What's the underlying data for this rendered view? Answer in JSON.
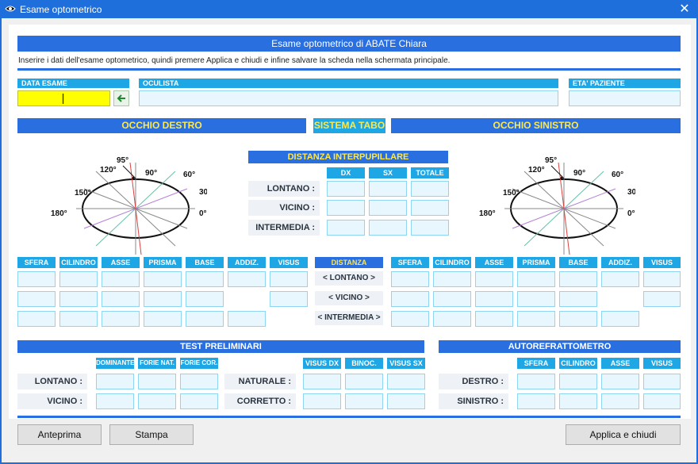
{
  "window": {
    "title": "Esame optometrico",
    "close_glyph": "✕"
  },
  "header": {
    "title": "Esame optometrico di ABATE Chiara",
    "instructions": "Inserire i dati dell'esame optometrico, quindi premere Applica e chiudi e infine salvare la scheda nella schermata principale."
  },
  "top_fields": {
    "date_label": "DATA ESAME",
    "date_value": "",
    "oculist_label": "OCULISTA",
    "oculist_value": "",
    "age_label": "ETA' PAZIENTE",
    "age_value": "",
    "arrow_icon": "arrow-left-icon"
  },
  "eyes": {
    "right_title": "OCCHIO DESTRO",
    "tabo_title": "SISTEMA TABO",
    "left_title": "OCCHIO SINISTRO",
    "angle_labels": [
      "95°",
      "120°",
      "90°",
      "60°",
      "150°",
      "30°",
      "180°",
      "0°"
    ]
  },
  "interpupillary": {
    "title": "DISTANZA INTERPUPILLARE",
    "columns": [
      "DX",
      "SX",
      "TOTALE"
    ],
    "rows": [
      "LONTANO :",
      "VICINO :",
      "INTERMEDIA :"
    ]
  },
  "prescription": {
    "columns": [
      "SFERA",
      "CILINDRO",
      "ASSE",
      "PRISMA",
      "BASE",
      "ADDIZ.",
      "VISUS"
    ],
    "distance_header": "DISTANZA",
    "distance_buttons": [
      "< LONTANO >",
      "< VICINO >",
      "< INTERMEDIA >"
    ]
  },
  "preliminary": {
    "title": "TEST PRELIMINARI",
    "columns_left": [
      "DOMINANTE",
      "FORIE NAT.",
      "FORIE COR."
    ],
    "rows_left": [
      "LONTANO :",
      "VICINO :"
    ],
    "columns_right": [
      "VISUS DX",
      "BINOC.",
      "VISUS SX"
    ],
    "rows_right": [
      "NATURALE :",
      "CORRETTO :"
    ]
  },
  "autorefract": {
    "title": "AUTOREFRATTOMETRO",
    "columns": [
      "SFERA",
      "CILINDRO",
      "ASSE",
      "VISUS"
    ],
    "rows": [
      "DESTRO :",
      "SINISTRO :"
    ]
  },
  "buttons": {
    "preview": "Anteprima",
    "print": "Stampa",
    "apply": "Applica e chiudi"
  },
  "colors": {
    "titlebar": "#1e6fdc",
    "header_bar": "#2a6fe0",
    "subheader": "#1ea7e4",
    "yellow_title": "#ffe94a",
    "date_field": "#ffff00"
  }
}
